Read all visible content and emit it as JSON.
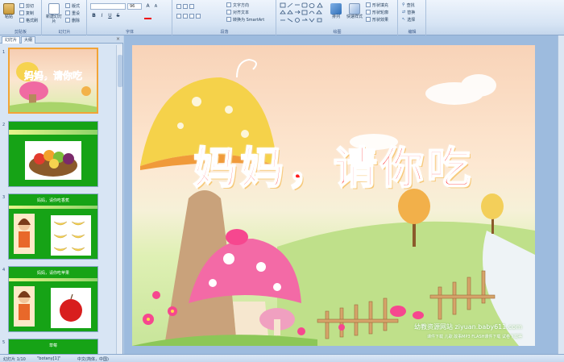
{
  "ribbon": {
    "clipboard": {
      "label": "剪贴板",
      "paste": "粘贴",
      "cut": "剪切",
      "copy": "复制",
      "format_painter": "格式刷"
    },
    "slides": {
      "label": "幻灯片",
      "new_slide": "新建幻灯片",
      "layout": "版式",
      "reset": "重设",
      "delete": "删除"
    },
    "font": {
      "label": "字体",
      "font_name": "",
      "font_size": "96",
      "bold": "B",
      "italic": "I",
      "underline": "U",
      "strike": "S",
      "grow": "A",
      "shrink": "A"
    },
    "paragraph": {
      "label": "段落",
      "text_direction": "文字方向",
      "align_text": "对齐文本",
      "smartart": "转换为 SmartArt"
    },
    "drawing": {
      "label": "绘图",
      "arrange": "排列",
      "quick_styles": "快速样式",
      "shape_fill": "形状填充",
      "shape_outline": "形状轮廓",
      "shape_effects": "形状效果"
    },
    "editing": {
      "label": "编辑",
      "find": "查找",
      "replace": "替换",
      "select": "选择"
    }
  },
  "panel": {
    "tab_slides": "幻灯片",
    "tab_outline": "大纲",
    "close": "×",
    "thumbnails": [
      {
        "num": "1",
        "title": "妈妈，请你吃"
      },
      {
        "num": "2",
        "title": ""
      },
      {
        "num": "3",
        "title": "妈妈，请你吃香蕉"
      },
      {
        "num": "4",
        "title": "妈妈，请你吃苹果"
      },
      {
        "num": "5",
        "title": "草莓"
      }
    ]
  },
  "slide": {
    "title": "妈妈，请你吃",
    "watermark_site": "幼教资源网站 ziyuan.baby611.com",
    "watermark_sub": "课件下载  儿歌  故事MP3  FLASH课件下载  试卷下载等"
  },
  "status": {
    "slide_pos": "幻灯片 1/10",
    "theme": "\"botany[1]\"",
    "language": "中文(简体，中国)"
  },
  "colors": {
    "title_red": "#ff1a1a",
    "selection": "#f2a436",
    "thumb_green": "#1aa31a"
  }
}
